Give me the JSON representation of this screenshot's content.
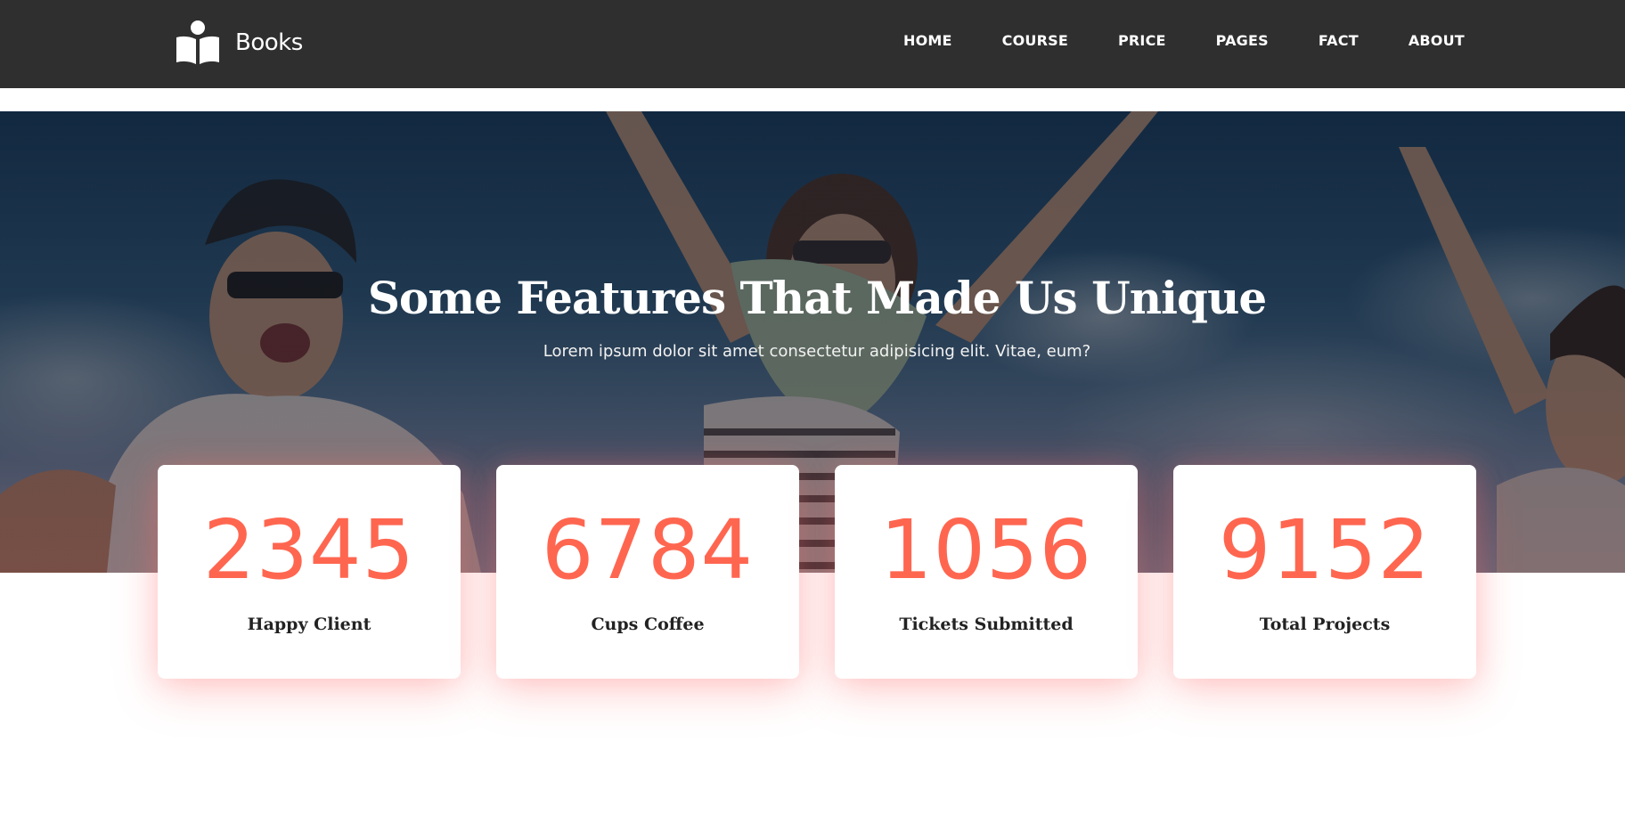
{
  "brand": {
    "name": "Books",
    "icon": "book-reader-icon"
  },
  "nav": {
    "items": [
      {
        "label": "HOME"
      },
      {
        "label": "COURSE"
      },
      {
        "label": "PRICE"
      },
      {
        "label": "PAGES"
      },
      {
        "label": "FACT"
      },
      {
        "label": "ABOUT"
      }
    ]
  },
  "hero": {
    "title": "Some Features That Made Us Unique",
    "subtitle": "Lorem ipsum dolor sit amet consectetur adipisicing elit. Vitae, eum?"
  },
  "stats": [
    {
      "value": "2345",
      "label": "Happy Client"
    },
    {
      "value": "6784",
      "label": "Cups Coffee"
    },
    {
      "value": "1056",
      "label": "Tickets Submitted"
    },
    {
      "value": "9152",
      "label": "Total Projects"
    }
  ],
  "colors": {
    "navbar_bg": "#2f2f2f",
    "accent": "#ff6650",
    "text_dark": "#222222",
    "text_light": "#ffffff"
  }
}
